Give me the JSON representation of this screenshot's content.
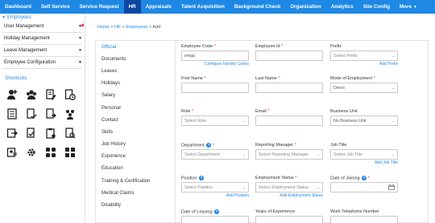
{
  "nav": {
    "items": [
      "Dashboard",
      "Self Service",
      "Service Request",
      "HR",
      "Appraisals",
      "Talent Acquisition",
      "Background Check",
      "Organization",
      "Analytics",
      "Site Config",
      "More"
    ],
    "active": "HR"
  },
  "sidebar": {
    "section_title": "Employees",
    "items": [
      {
        "label": "User Management"
      },
      {
        "label": "Holiday Management"
      },
      {
        "label": "Leave Management"
      },
      {
        "label": "Employee Configuration"
      }
    ],
    "shortcuts_label": "Shortcuts",
    "shortcut_icons": [
      "add-user-icon",
      "group-user-icon",
      "edit-document-icon",
      "clock-document-icon",
      "list-document-icon",
      "approve-document-icon",
      "export-document-icon",
      "team-icon",
      "transfer-document-icon",
      "edit-profile-icon",
      "clipboard-icon",
      "grid-icon",
      "user-search-icon",
      "settings-icon",
      "apps-icon",
      "dashboard-icon"
    ]
  },
  "breadcrumb": {
    "home": "Home",
    "sep": ">",
    "hr": "HR",
    "employees": "Employees",
    "current": "Add"
  },
  "tabs": [
    "Official",
    "Documents",
    "Leaves",
    "Holidays",
    "Salary",
    "Personal",
    "Contact",
    "Skills",
    "Job History",
    "Experience",
    "Education",
    "Training & Certification",
    "Medical Claims",
    "Disability"
  ],
  "active_tab": "Official",
  "form": {
    "employee_code": {
      "label": "Employee Code",
      "value": "empp",
      "link": "Configure Identity Codes"
    },
    "employee_id": {
      "label": "Employee Id"
    },
    "prefix": {
      "label": "Prefix",
      "placeholder": "Select Prefix",
      "link": "Add Prefix"
    },
    "first_name": {
      "label": "First Name"
    },
    "last_name": {
      "label": "Last Name"
    },
    "mode_of_employment": {
      "label": "Mode of Employment",
      "value": "Direct"
    },
    "role": {
      "label": "Role",
      "placeholder": "Select Role"
    },
    "email": {
      "label": "Email"
    },
    "business_unit": {
      "label": "Business Unit",
      "value": "No Business Unit"
    },
    "department": {
      "label": "Department",
      "placeholder": "Select Department"
    },
    "reporting_manager": {
      "label": "Reporting Manager",
      "placeholder": "Select Reporting Manager"
    },
    "job_title": {
      "label": "Job Title",
      "placeholder": "Select Job Title",
      "link": "Add Job Title"
    },
    "position": {
      "label": "Position",
      "placeholder": "Select Position",
      "link": "Add Position"
    },
    "employment_status": {
      "label": "Employment Status",
      "placeholder": "Select Employment Status",
      "link": "Add Employment Status"
    },
    "date_of_joining": {
      "label": "Date of Joining"
    },
    "date_of_leaving": {
      "label": "Date of Leaving"
    },
    "years_of_experience": {
      "label": "Years of Experience"
    },
    "work_telephone": {
      "label": "Work Telephone Number"
    }
  },
  "colors": {
    "nav_bg": "#1e88e5",
    "nav_active": "#0d47a1",
    "link": "#1e88e5",
    "required": "#e53935"
  }
}
